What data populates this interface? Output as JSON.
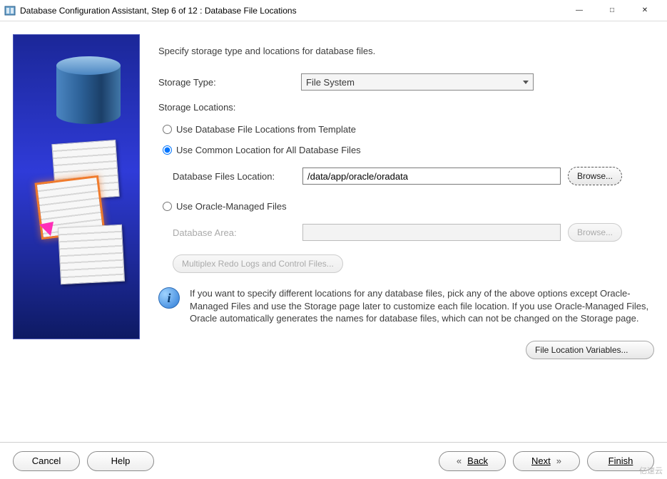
{
  "window": {
    "title": "Database Configuration Assistant, Step 6 of 12 : Database File Locations"
  },
  "form": {
    "instruction": "Specify storage type and locations for database files.",
    "storage_type_label": "Storage Type:",
    "storage_type_value": "File System",
    "storage_locations_label": "Storage Locations:",
    "option_template": "Use Database File Locations from Template",
    "option_common": "Use Common Location for All Database Files",
    "db_files_location_label": "Database Files Location:",
    "db_files_location_value": "/data/app/oracle/oradata",
    "browse_label": "Browse...",
    "option_omf": "Use Oracle-Managed Files",
    "db_area_label": "Database Area:",
    "db_area_value": "",
    "multiplex_label": "Multiplex Redo Logs and Control Files...",
    "info_text": "If you want to specify different locations for any database files, pick any of the above options except Oracle-Managed Files and use the Storage page later to customize each file location. If you use Oracle-Managed Files, Oracle automatically generates the names for database files, which can not be changed on the Storage page.",
    "file_location_variables_label": "File Location Variables..."
  },
  "buttons": {
    "cancel": "Cancel",
    "help": "Help",
    "back": "Back",
    "next": "Next",
    "finish": "Finish"
  },
  "watermark": "亿速云"
}
